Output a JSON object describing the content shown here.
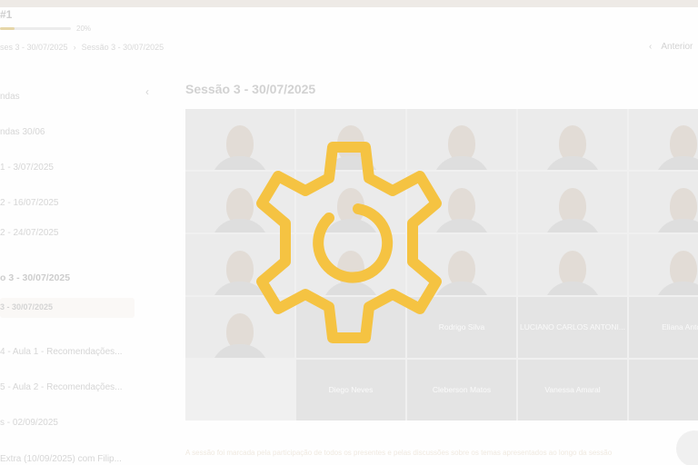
{
  "header": {
    "course_title": "#1",
    "progress_label": "20%",
    "progress_value": 0.2,
    "breadcrumb": [
      "ses 3 - 30/07/2025",
      "Sessão 3 - 30/07/2025"
    ],
    "prev_label": "Anterior"
  },
  "sidebar": {
    "items": [
      {
        "label": "ndas"
      },
      {
        "label": "ndas 30/06"
      },
      {
        "label": "1 - 3/07/2025"
      },
      {
        "label": "2 - 16/07/2025"
      },
      {
        "label": "2 - 24/07/2025"
      },
      {
        "label": "o 3 - 30/07/2025"
      },
      {
        "label": "3 - 30/07/2025"
      },
      {
        "label": "4 - Aula 1 - Recomendações..."
      },
      {
        "label": "5 - Aula 2 - Recomendações..."
      },
      {
        "label": "s - 02/09/2025"
      },
      {
        "label": "Extra (10/09/2025) com Filip..."
      }
    ]
  },
  "content": {
    "title": "Sessão 3 - 30/07/2025",
    "participants": [
      "Rodrigo Silva",
      "LUCIANO CARLOS ANTONI...",
      "Eliana Anton",
      "Diego Neves",
      "Cleberson Matos",
      "Vanessa Amaral"
    ],
    "caption": "A sessão foi marcada pela participação de todos os presentes e pelas discussões sobre os temas apresentados ao longo da sessão"
  },
  "colors": {
    "gear": "#f5c342",
    "accent": "#e6d6a8"
  },
  "icons": {
    "overlay": "gear-icon",
    "chat": "chat-icon",
    "collapse": "chevron-left-icon",
    "prev": "chevron-left-icon"
  }
}
